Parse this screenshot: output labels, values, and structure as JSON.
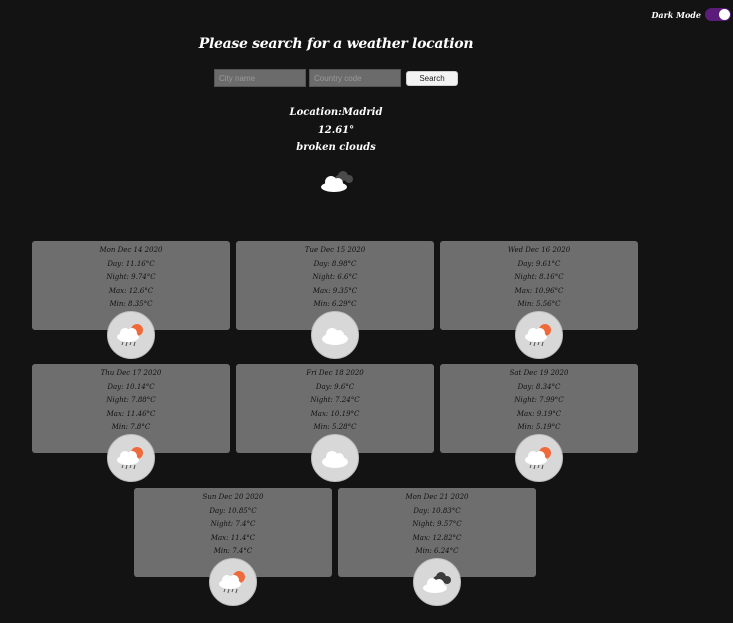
{
  "dark_mode": {
    "label": "Dark Mode",
    "enabled": true,
    "accent": "#5b1c7a"
  },
  "header": {
    "title": "Please search for a weather location"
  },
  "search": {
    "city_placeholder": "City name",
    "country_placeholder": "Country code",
    "button_label": "Search"
  },
  "current": {
    "location": "Location:Madrid",
    "temperature": "12.61°",
    "description": "broken clouds",
    "icon": "broken-clouds-icon"
  },
  "forecast": [
    {
      "date": "Mon Dec 14 2020",
      "day": "Day: 11.16°C",
      "night": "Night: 9.74°C",
      "max": "Max: 12.6°C",
      "min": "Min: 8.35°C",
      "icon": "rain-icon"
    },
    {
      "date": "Tue Dec 15 2020",
      "day": "Day: 8.98°C",
      "night": "Night: 6.6°C",
      "max": "Max: 9.35°C",
      "min": "Min: 6.29°C",
      "icon": "cloud-icon"
    },
    {
      "date": "Wed Dec 16 2020",
      "day": "Day: 9.61°C",
      "night": "Night: 8.16°C",
      "max": "Max: 10.96°C",
      "min": "Min: 5.56°C",
      "icon": "rain-icon"
    },
    {
      "date": "Thu Dec 17 2020",
      "day": "Day: 10.14°C",
      "night": "Night: 7.88°C",
      "max": "Max: 11.46°C",
      "min": "Min: 7.8°C",
      "icon": "rain-icon"
    },
    {
      "date": "Fri Dec 18 2020",
      "day": "Day: 9.6°C",
      "night": "Night: 7.24°C",
      "max": "Max: 10.19°C",
      "min": "Min: 5.28°C",
      "icon": "cloud-icon"
    },
    {
      "date": "Sat Dec 19 2020",
      "day": "Day: 8.34°C",
      "night": "Night: 7.99°C",
      "max": "Max: 9.19°C",
      "min": "Min: 5.19°C",
      "icon": "rain-icon"
    },
    {
      "date": "Sun Dec 20 2020",
      "day": "Day: 10.85°C",
      "night": "Night: 7.4°C",
      "max": "Max: 11.4°C",
      "min": "Min: 7.4°C",
      "icon": "rain-icon"
    },
    {
      "date": "Mon Dec 21 2020",
      "day": "Day: 10.83°C",
      "night": "Night: 9.57°C",
      "max": "Max: 12.82°C",
      "min": "Min: 6.24°C",
      "icon": "broken-clouds-icon"
    }
  ]
}
